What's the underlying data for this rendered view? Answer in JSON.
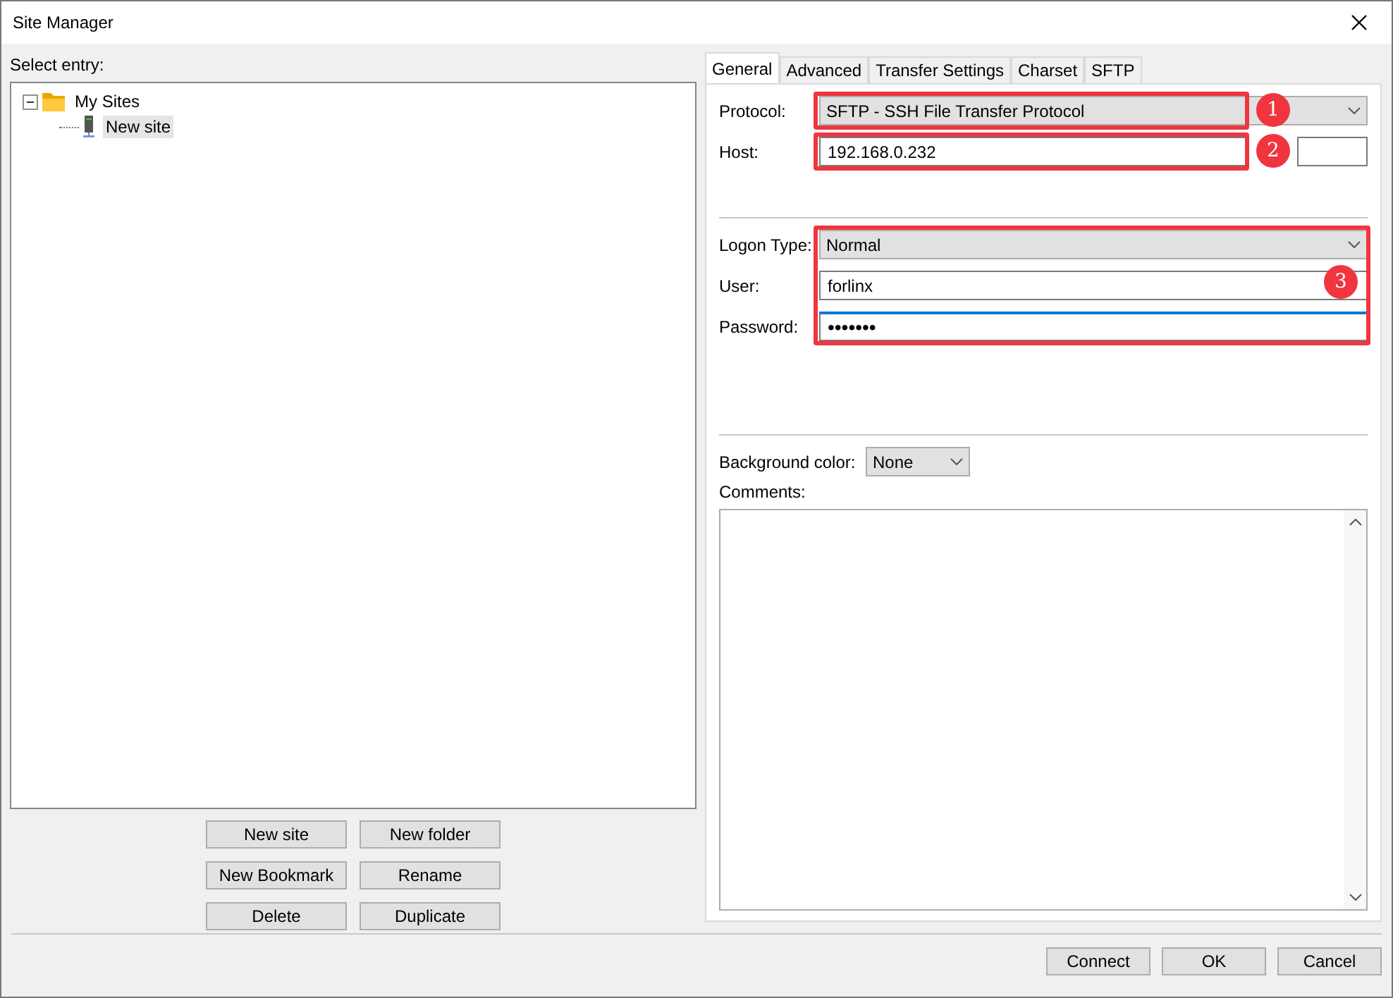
{
  "window": {
    "title": "Site Manager"
  },
  "entry_label": "Select entry:",
  "tree": [
    {
      "label": "My Sites",
      "kind": "folder",
      "expanded": true,
      "selected": false,
      "children": [
        {
          "label": "New site",
          "kind": "site",
          "selected": true
        }
      ]
    }
  ],
  "tree_buttons": [
    [
      "New site",
      "New folder"
    ],
    [
      "New Bookmark",
      "Rename"
    ],
    [
      "Delete",
      "Duplicate"
    ]
  ],
  "tabs": [
    {
      "label": "General",
      "selected": true
    },
    {
      "label": "Advanced",
      "selected": false
    },
    {
      "label": "Transfer Settings",
      "selected": false
    },
    {
      "label": "Charset",
      "selected": false
    },
    {
      "label": "SFTP",
      "selected": false
    }
  ],
  "protocol": {
    "label": "Protocol:",
    "value": "SFTP - SSH File Transfer Protocol"
  },
  "host": {
    "label": "Host:",
    "value": "192.168.0.232"
  },
  "logon_type": {
    "label": "Logon Type:",
    "value": "Normal"
  },
  "user": {
    "label": "User:",
    "value": "forlinx"
  },
  "password": {
    "label": "Password:",
    "value": "•••••••"
  },
  "background_color": {
    "label": "Background color:",
    "value": "None"
  },
  "comments": {
    "label": "Comments:"
  },
  "annotations": [
    {
      "label": "1"
    },
    {
      "label": "2"
    },
    {
      "label": "3"
    }
  ],
  "buttons": [
    "Connect",
    "OK",
    "Cancel"
  ]
}
